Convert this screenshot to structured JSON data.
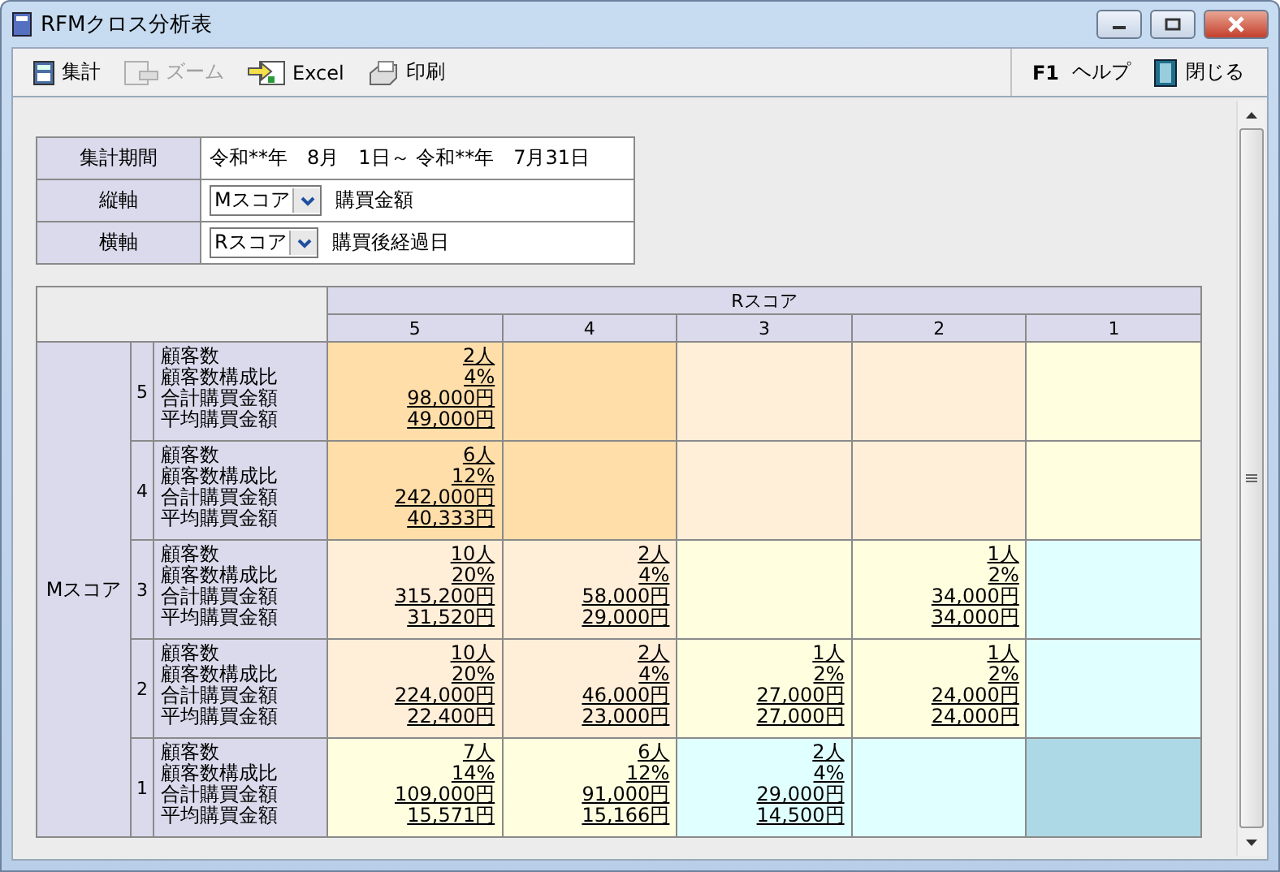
{
  "window": {
    "title": "RFMクロス分析表"
  },
  "toolbar": {
    "left": [
      {
        "kind": "calc",
        "label": "集計",
        "disabled": false
      },
      {
        "kind": "zoom",
        "label": "ズーム",
        "disabled": true
      },
      {
        "kind": "excel",
        "label": "Excel",
        "disabled": false
      },
      {
        "kind": "print",
        "label": "印刷",
        "disabled": false
      }
    ],
    "right": [
      {
        "kind": "help",
        "key": "F1",
        "label": "ヘルプ"
      },
      {
        "kind": "close",
        "label": "閉じる"
      }
    ]
  },
  "conditions": {
    "period": {
      "label": "集計期間",
      "value": "令和**年　8月　1日～ 令和**年　7月31日"
    },
    "axes": [
      {
        "label": "縦軸",
        "select": "Mスコア",
        "description": "購買金額"
      },
      {
        "label": "横軸",
        "select": "Rスコア",
        "description": "購買後経過日"
      }
    ]
  },
  "cross_table": {
    "column_axis": "Rスコア",
    "row_axis": "Mスコア",
    "columns": [
      "5",
      "4",
      "3",
      "2",
      "1"
    ],
    "rows": [
      {
        "score": "5",
        "labels": [
          "顧客数",
          "顧客数構成比",
          "合計購買金額",
          "平均購買金額"
        ],
        "cells": [
          {
            "color": "#ffdeaa",
            "values": [
              "2人",
              "4%",
              "98,000円",
              "49,000円"
            ]
          },
          {
            "color": "#ffdeaa"
          },
          {
            "color": "#ffeed8"
          },
          {
            "color": "#ffeed8"
          },
          {
            "color": "#ffffe0"
          }
        ]
      },
      {
        "score": "4",
        "labels": [
          "顧客数",
          "顧客数構成比",
          "合計購買金額",
          "平均購買金額"
        ],
        "cells": [
          {
            "color": "#ffdeaa",
            "values": [
              "6人",
              "12%",
              "242,000円",
              "40,333円"
            ]
          },
          {
            "color": "#ffdeaa"
          },
          {
            "color": "#ffeed8"
          },
          {
            "color": "#ffeed8"
          },
          {
            "color": "#ffffe0"
          }
        ]
      },
      {
        "score": "3",
        "labels": [
          "顧客数",
          "顧客数構成比",
          "合計購買金額",
          "平均購買金額"
        ],
        "cells": [
          {
            "color": "#ffeed8",
            "values": [
              "10人",
              "20%",
              "315,200円",
              "31,520円"
            ]
          },
          {
            "color": "#ffeed8",
            "values": [
              "2人",
              "4%",
              "58,000円",
              "29,000円"
            ]
          },
          {
            "color": "#ffffe0"
          },
          {
            "color": "#ffffe0",
            "values": [
              "1人",
              "2%",
              "34,000円",
              "34,000円"
            ]
          },
          {
            "color": "#e0ffff"
          }
        ]
      },
      {
        "score": "2",
        "labels": [
          "顧客数",
          "顧客数構成比",
          "合計購買金額",
          "平均購買金額"
        ],
        "cells": [
          {
            "color": "#ffeed8",
            "values": [
              "10人",
              "20%",
              "224,000円",
              "22,400円"
            ]
          },
          {
            "color": "#ffeed8",
            "values": [
              "2人",
              "4%",
              "46,000円",
              "23,000円"
            ]
          },
          {
            "color": "#ffffe0",
            "values": [
              "1人",
              "2%",
              "27,000円",
              "27,000円"
            ]
          },
          {
            "color": "#ffffe0",
            "values": [
              "1人",
              "2%",
              "24,000円",
              "24,000円"
            ]
          },
          {
            "color": "#e0ffff"
          }
        ]
      },
      {
        "score": "1",
        "labels": [
          "顧客数",
          "顧客数構成比",
          "合計購買金額",
          "平均購買金額"
        ],
        "cells": [
          {
            "color": "#ffffe0",
            "values": [
              "7人",
              "14%",
              "109,000円",
              "15,571円"
            ]
          },
          {
            "color": "#ffffe0",
            "values": [
              "6人",
              "12%",
              "91,000円",
              "15,166円"
            ]
          },
          {
            "color": "#e0ffff",
            "values": [
              "2人",
              "4%",
              "29,000円",
              "14,500円"
            ]
          },
          {
            "color": "#e0ffff"
          },
          {
            "color": "#add8e6"
          }
        ]
      }
    ]
  }
}
